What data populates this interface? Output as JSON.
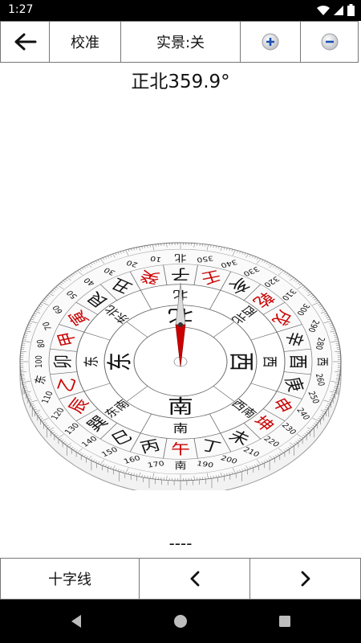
{
  "status": {
    "time": "1:27"
  },
  "toolbar": {
    "calibrate_label": "校准",
    "live_view_label": "实景:关",
    "zoom_in_glyph": "+",
    "zoom_out_glyph": "−",
    "back_glyph": "←"
  },
  "heading": {
    "text": "正北359.9°"
  },
  "compass": {
    "outer_ring_labels": [
      "南",
      "170",
      "160",
      "150",
      "140",
      "130",
      "120",
      "110",
      "东",
      "100",
      "80",
      "70",
      "60",
      "50",
      "40",
      "30",
      "20",
      "10",
      "北",
      "350",
      "340",
      "330",
      "320",
      "310",
      "300",
      "290",
      "280",
      "西",
      "260",
      "250",
      "240",
      "230",
      "220",
      "210",
      "200",
      "190"
    ],
    "mountains": [
      {
        "c": "午",
        "red": true
      },
      {
        "c": "丙",
        "red": false
      },
      {
        "c": "巳",
        "red": false
      },
      {
        "c": "巽",
        "red": false
      },
      {
        "c": "辰",
        "red": true
      },
      {
        "c": "乙",
        "red": true
      },
      {
        "c": "卯",
        "red": false
      },
      {
        "c": "甲",
        "red": true
      },
      {
        "c": "寅",
        "red": true
      },
      {
        "c": "艮",
        "red": false
      },
      {
        "c": "丑",
        "red": false
      },
      {
        "c": "癸",
        "red": true
      },
      {
        "c": "子",
        "red": false
      },
      {
        "c": "壬",
        "red": true
      },
      {
        "c": "亥",
        "red": false
      },
      {
        "c": "乾",
        "red": true
      },
      {
        "c": "戌",
        "red": true
      },
      {
        "c": "辛",
        "red": false
      },
      {
        "c": "酉",
        "red": false
      },
      {
        "c": "庚",
        "red": false
      },
      {
        "c": "申",
        "red": true
      },
      {
        "c": "坤",
        "red": true
      },
      {
        "c": "未",
        "red": false
      },
      {
        "c": "丁",
        "red": false
      }
    ],
    "trigram_labels": [
      "南",
      "东南",
      "东",
      "东北",
      "北",
      "西北",
      "西",
      "西南"
    ],
    "cardinal_labels": [
      "南",
      "东",
      "北",
      "西"
    ]
  },
  "dash_text": "----",
  "bottom": {
    "crosshair_label": "十字线",
    "prev_glyph": "<",
    "next_glyph": ">"
  },
  "colors": {
    "accent_red": "#cc0000",
    "zoom_blue": "#1a4fb0",
    "nav_bg": "#000000"
  }
}
